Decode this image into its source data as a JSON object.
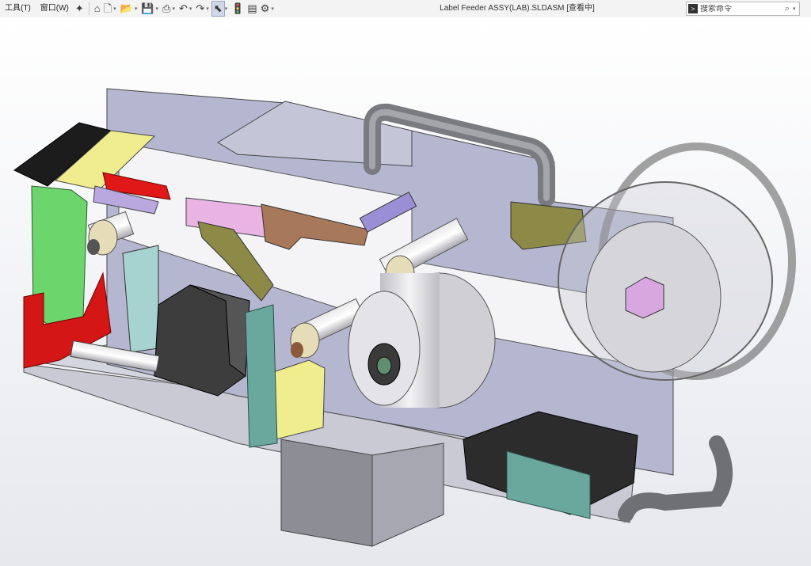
{
  "menu": [
    {
      "id": "tools",
      "label": "工具(T)"
    },
    {
      "id": "window",
      "label": "窗口(W)"
    }
  ],
  "toolbar": {
    "pin": "✦",
    "home": "⌂",
    "new": "🗋",
    "open": "📂",
    "save": "💾",
    "print": "⎙",
    "undo": "↶",
    "redo": "↷",
    "select": "⬉",
    "rebuild": "🚦",
    "file_props": "▤",
    "options": "⚙",
    "dropdown": "▾"
  },
  "document": {
    "title": "Label Feeder ASSY(LAB).SLDASM [查看中]"
  },
  "search": {
    "placeholder": "搜索命令",
    "prompt": ">",
    "icon": "⌕"
  },
  "heads_up": [
    {
      "id": "zoom-fit",
      "glyph": "⤢"
    },
    {
      "id": "zoom-area",
      "glyph": "🔍"
    },
    {
      "id": "previous-view",
      "glyph": "↺"
    },
    {
      "id": "section-view",
      "glyph": "◧"
    },
    {
      "id": "dynamic-annotation",
      "glyph": "▣"
    },
    {
      "id": "view-orientation",
      "glyph": "⬚"
    },
    {
      "id": "display-style",
      "glyph": "◆"
    },
    {
      "id": "hide-show",
      "glyph": "◉"
    },
    {
      "id": "edit-appearance",
      "glyph": "◐"
    },
    {
      "id": "apply-scene",
      "glyph": "☁"
    },
    {
      "id": "view-settings",
      "glyph": "▭"
    }
  ],
  "colors": {
    "viewport_bg_top": "#ffffff",
    "viewport_bg_bottom": "#e6e8ee",
    "frame_grey": "#8d8d91",
    "plate_lavender": "#b8bcd8",
    "label_white": "#f2f2f4",
    "yellow": "#f0ed8e",
    "red": "#d41616",
    "green": "#6cd66c",
    "olive": "#8c8a46",
    "pink": "#e9b4e4",
    "motor_dark": "#3d3d3d",
    "teal": "#6aa89e",
    "brown": "#a8785a"
  }
}
